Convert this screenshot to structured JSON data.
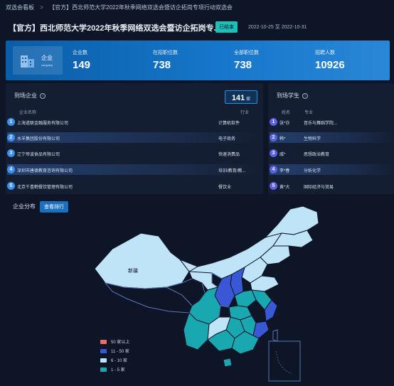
{
  "breadcrumb": {
    "home": "双选会看板",
    "current": "【官方】西北师范大学2022年秋季网络双选会暨访企拓岗专项行动双选会"
  },
  "header": {
    "title": "【官方】西北师范大学2022年秋季网络双选会暨访企拓岗专...",
    "badge": "已结束",
    "date_range": "2022-10-25 至 2022-10-31"
  },
  "stats": {
    "icon_label": "企业",
    "icon_sub": "company",
    "items": [
      {
        "label": "企业数",
        "value": "149"
      },
      {
        "label": "在招职位数",
        "value": "738"
      },
      {
        "label": "全部职位数",
        "value": "738"
      },
      {
        "label": "招聘人数",
        "value": "10926"
      }
    ]
  },
  "companies": {
    "title": "到场企业",
    "count": "141",
    "count_unit": "家",
    "col_name": "企业名称",
    "col_industry": "行业",
    "rows": [
      {
        "rank": "1",
        "name": "上海道联金融服务有限公司",
        "industry": "计算机软件"
      },
      {
        "rank": "2",
        "name": "水羊集团股份有限公司",
        "industry": "电子商务"
      },
      {
        "rank": "3",
        "name": "辽宁帝波食品有限公司",
        "industry": "快速消费品"
      },
      {
        "rank": "4",
        "name": "深圳市唐德教育咨询有限公司",
        "industry": "培训/教育/教..."
      },
      {
        "rank": "5",
        "name": "北京千喜鹤餐饮管理有限公司",
        "industry": "餐饮业"
      }
    ]
  },
  "students": {
    "title": "到场学生",
    "col_name": "姓名",
    "col_major": "专业",
    "rows": [
      {
        "rank": "1",
        "name": "张*亦",
        "major": "音乐与舞蹈学院..."
      },
      {
        "rank": "2",
        "name": "韩*",
        "major": "生物科学"
      },
      {
        "rank": "3",
        "name": "戚*",
        "major": "思想政治教育"
      },
      {
        "rank": "4",
        "name": "李*春",
        "major": "分析化学"
      },
      {
        "rank": "5",
        "name": "黄*大",
        "major": "国际经济与贸易"
      }
    ]
  },
  "map": {
    "title": "企业分布",
    "button": "查看排行",
    "region_label": "新疆",
    "legend": [
      {
        "label": "50 家以上",
        "color": "#f06a6a"
      },
      {
        "label": "11 - 50 家",
        "color": "#3a58d6"
      },
      {
        "label": "6 - 10 家",
        "color": "#bfe3f7"
      },
      {
        "label": "1 - 5 家",
        "color": "#1aa8b0"
      }
    ]
  }
}
